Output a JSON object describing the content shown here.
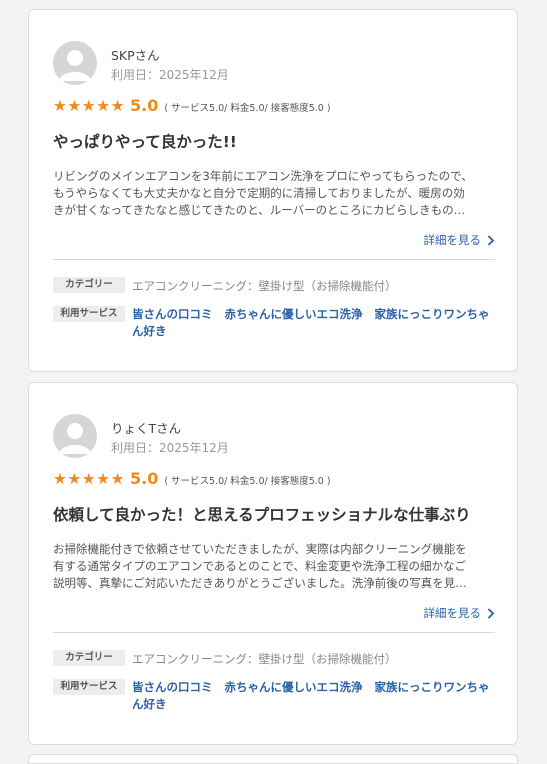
{
  "reviews": [
    {
      "name": "SKPさん",
      "date": "利用日：2025年12月",
      "stars": "★★★★★",
      "score": "5.0",
      "breakdown": "( サービス5.0/ 料金5.0/ 接客態度5.0 )",
      "title": "やっぱりやって良かった!!",
      "body_lines": [
        "リビングのメインエアコンを3年前にエアコン洗浄をプロにやってもらったので、",
        "もうやらなくても大丈夫かなと自分で定期的に清掃しておりましたが、暖房の効",
        "きが甘くなってきたなと感じてきたのと、ルーバーのところにカビらしきもの…"
      ],
      "more_label": "詳細を見る",
      "category_label": "カテゴリー",
      "category_value": "エアコンクリーニング：壁掛け型（お掃除機能付）",
      "service_label": "利用サービス",
      "services": [
        "皆さんの口コミ",
        "赤ちゃんに優しいエコ洗浄",
        "家族にっこりワンちゃん好き"
      ]
    },
    {
      "name": "りょくTさん",
      "date": "利用日：2025年12月",
      "stars": "★★★★★",
      "score": "5.0",
      "breakdown": "( サービス5.0/ 料金5.0/ 接客態度5.0 )",
      "title": "依頼して良かった！と思えるプロフェッショナルな仕事ぶり",
      "body_lines": [
        "お掃除機能付きで依頼させていただきましたが、実際は内部クリーニング機能を",
        "有する通常タイプのエアコンであるとのことで、料金変更や洗浄工程の細かなご",
        "説明等、真摯にご対応いただきありがとうございました。洗浄前後の写真を見…"
      ],
      "more_label": "詳細を見る",
      "category_label": "カテゴリー",
      "category_value": "エアコンクリーニング：壁掛け型（お掃除機能付）",
      "service_label": "利用サービス",
      "services": [
        "皆さんの口コミ",
        "赤ちゃんに優しいエコ洗浄",
        "家族にっこりワンちゃん好き"
      ]
    }
  ]
}
